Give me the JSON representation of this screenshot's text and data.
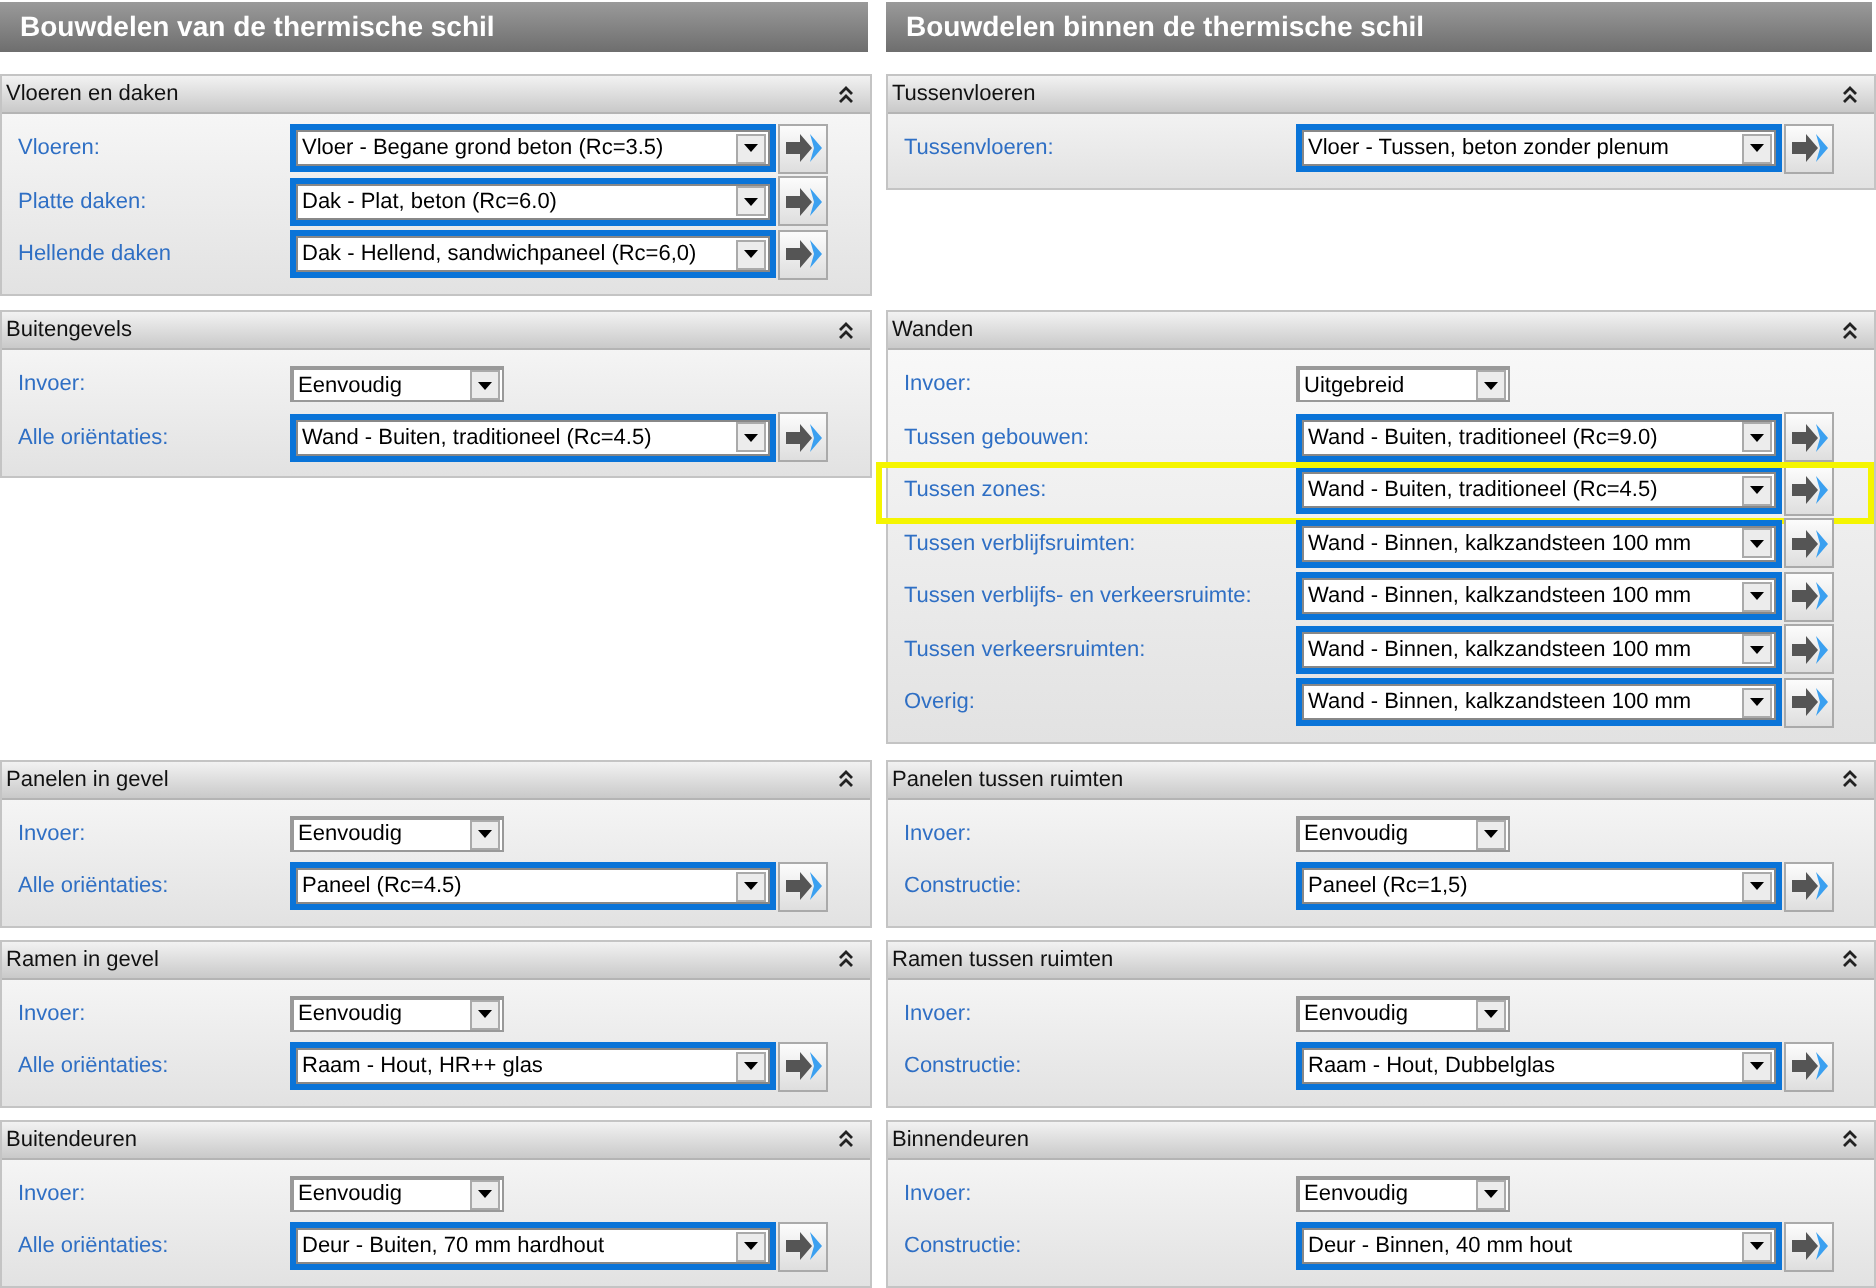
{
  "columns": [
    {
      "title": "Bouwdelen van de thermische schil",
      "sections": [
        {
          "title": "Vloeren en daken",
          "expanded": true,
          "rows": [
            {
              "kind": "construction",
              "label": "Vloeren:",
              "value": "Vloer - Begane grond beton (Rc=3.5)",
              "highlighted": false
            },
            {
              "kind": "construction",
              "label": "Platte daken:",
              "value": "Dak - Plat, beton (Rc=6.0)",
              "highlighted": false
            },
            {
              "kind": "construction",
              "label": "Hellende daken",
              "value": "Dak - Hellend, sandwichpaneel (Rc=6,0)",
              "highlighted": false
            }
          ]
        },
        {
          "title": "Buitengevels",
          "expanded": true,
          "rows": [
            {
              "kind": "mode",
              "label": "Invoer:",
              "value": "Eenvoudig",
              "highlighted": false
            },
            {
              "kind": "construction",
              "label": "Alle oriëntaties:",
              "value": "Wand - Buiten, traditioneel (Rc=4.5)",
              "highlighted": false
            }
          ]
        },
        {
          "title": "Panelen in gevel",
          "expanded": true,
          "rows": [
            {
              "kind": "mode",
              "label": "Invoer:",
              "value": "Eenvoudig",
              "highlighted": false
            },
            {
              "kind": "construction",
              "label": "Alle oriëntaties:",
              "value": "Paneel (Rc=4.5)",
              "highlighted": false
            }
          ]
        },
        {
          "title": "Ramen in gevel",
          "expanded": true,
          "rows": [
            {
              "kind": "mode",
              "label": "Invoer:",
              "value": "Eenvoudig",
              "highlighted": false
            },
            {
              "kind": "construction",
              "label": "Alle oriëntaties:",
              "value": "Raam - Hout, HR++ glas",
              "highlighted": false
            }
          ]
        },
        {
          "title": "Buitendeuren",
          "expanded": true,
          "rows": [
            {
              "kind": "mode",
              "label": "Invoer:",
              "value": "Eenvoudig",
              "highlighted": false
            },
            {
              "kind": "construction",
              "label": "Alle oriëntaties:",
              "value": "Deur - Buiten, 70 mm hardhout",
              "highlighted": false
            }
          ]
        }
      ]
    },
    {
      "title": "Bouwdelen binnen de thermische schil",
      "sections": [
        {
          "title": "Tussenvloeren",
          "expanded": true,
          "rows": [
            {
              "kind": "construction",
              "label": "Tussenvloeren:",
              "value": "Vloer - Tussen, beton zonder plenum",
              "highlighted": false
            }
          ]
        },
        {
          "title": "Wanden",
          "expanded": true,
          "rows": [
            {
              "kind": "mode",
              "label": "Invoer:",
              "value": "Uitgebreid",
              "highlighted": false
            },
            {
              "kind": "construction",
              "label": "Tussen gebouwen:",
              "value": "Wand - Buiten, traditioneel (Rc=9.0)",
              "highlighted": false
            },
            {
              "kind": "construction",
              "label": "Tussen zones:",
              "value": "Wand - Buiten, traditioneel (Rc=4.5)",
              "highlighted": true
            },
            {
              "kind": "construction",
              "label": "Tussen verblijfsruimten:",
              "value": "Wand - Binnen, kalkzandsteen 100 mm",
              "highlighted": false
            },
            {
              "kind": "construction",
              "label": "Tussen verblijfs- en verkeersruimte:",
              "value": "Wand - Binnen, kalkzandsteen 100 mm",
              "highlighted": false
            },
            {
              "kind": "construction",
              "label": "Tussen verkeersruimten:",
              "value": "Wand - Binnen, kalkzandsteen 100 mm",
              "highlighted": false
            },
            {
              "kind": "construction",
              "label": "Overig:",
              "value": "Wand - Binnen, kalkzandsteen 100 mm",
              "highlighted": false
            }
          ]
        },
        {
          "title": "Panelen tussen ruimten",
          "expanded": true,
          "rows": [
            {
              "kind": "mode",
              "label": "Invoer:",
              "value": "Eenvoudig",
              "highlighted": false
            },
            {
              "kind": "construction",
              "label": "Constructie:",
              "value": "Paneel (Rc=1,5)",
              "highlighted": false
            }
          ]
        },
        {
          "title": "Ramen tussen ruimten",
          "expanded": true,
          "rows": [
            {
              "kind": "mode",
              "label": "Invoer:",
              "value": "Eenvoudig",
              "highlighted": false
            },
            {
              "kind": "construction",
              "label": "Constructie:",
              "value": "Raam - Hout, Dubbelglas",
              "highlighted": false
            }
          ]
        },
        {
          "title": "Binnendeuren",
          "expanded": true,
          "rows": [
            {
              "kind": "mode",
              "label": "Invoer:",
              "value": "Eenvoudig",
              "highlighted": false
            },
            {
              "kind": "construction",
              "label": "Constructie:",
              "value": "Deur - Binnen, 40 mm hout",
              "highlighted": false
            }
          ]
        }
      ]
    }
  ]
}
